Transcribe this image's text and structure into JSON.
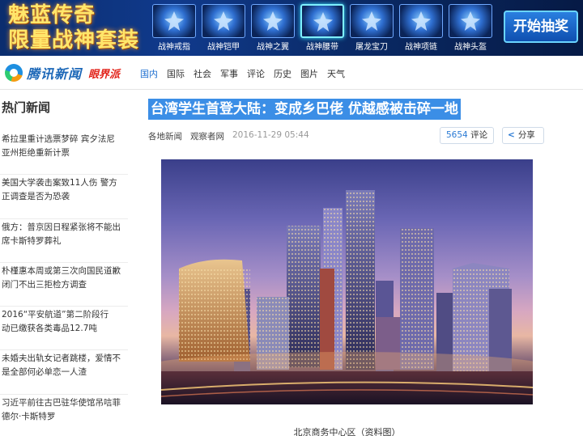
{
  "ad": {
    "title_line1": "魅蓝传奇",
    "title_line2": "限量战神套装",
    "items": [
      {
        "label": "战神戒指",
        "icon": "ring-icon"
      },
      {
        "label": "战神铠甲",
        "icon": "armor-icon"
      },
      {
        "label": "战神之翼",
        "icon": "wings-icon"
      },
      {
        "label": "战神腰带",
        "icon": "belt-icon",
        "selected": true
      },
      {
        "label": "屠龙宝刀",
        "icon": "sword-icon"
      },
      {
        "label": "战神项链",
        "icon": "necklace-icon"
      },
      {
        "label": "战神头盔",
        "icon": "helmet-icon"
      }
    ],
    "cta": "开始抽奖"
  },
  "nav": {
    "logo_text": "腾讯新闻",
    "logo_sub": "眼界派",
    "links": [
      "国内",
      "国际",
      "社会",
      "军事",
      "评论",
      "历史",
      "图片",
      "天气"
    ],
    "active": "国内"
  },
  "sidebar": {
    "title": "热门新闻",
    "items": [
      {
        "line1": "希拉里重计选票梦碎 宾夕法尼",
        "line2": "亚州拒绝重新计票"
      },
      {
        "line1": "美国大学袭击案致11人伤 警方",
        "line2": "正调查是否为恐袭"
      },
      {
        "line1": "俄方：普京因日程紧张将不能出",
        "line2": "席卡斯特罗葬礼"
      },
      {
        "line1": "朴槿惠本周或第三次向国民道歉",
        "line2": "闭门不出三拒检方调查"
      },
      {
        "line1": "2016“平安航道”第二阶段行",
        "line2": "动已缴获各类毒品12.7吨"
      },
      {
        "line1": "未婚夫出轨女记者跳楼，爱情不",
        "line2": "是全部何必单恋一人渣"
      },
      {
        "line1": "习近平前往古巴驻华使馆吊唁菲",
        "line2": "德尔·卡斯特罗"
      }
    ]
  },
  "article": {
    "headline": "台湾学生首登大陆：变成乡巴佬 优越感被击碎一地",
    "source": "各地新闻",
    "outlet": "观察者网",
    "date": "2016-11-29 05:44",
    "comment_count": "5654",
    "comment_label": "评论",
    "share_label": "分享",
    "caption": "北京商务中心区（资料图）"
  },
  "colors": {
    "accent": "#1e6fd0",
    "headline_bg": "#3b8ee6",
    "brand_red": "#e2231a"
  }
}
